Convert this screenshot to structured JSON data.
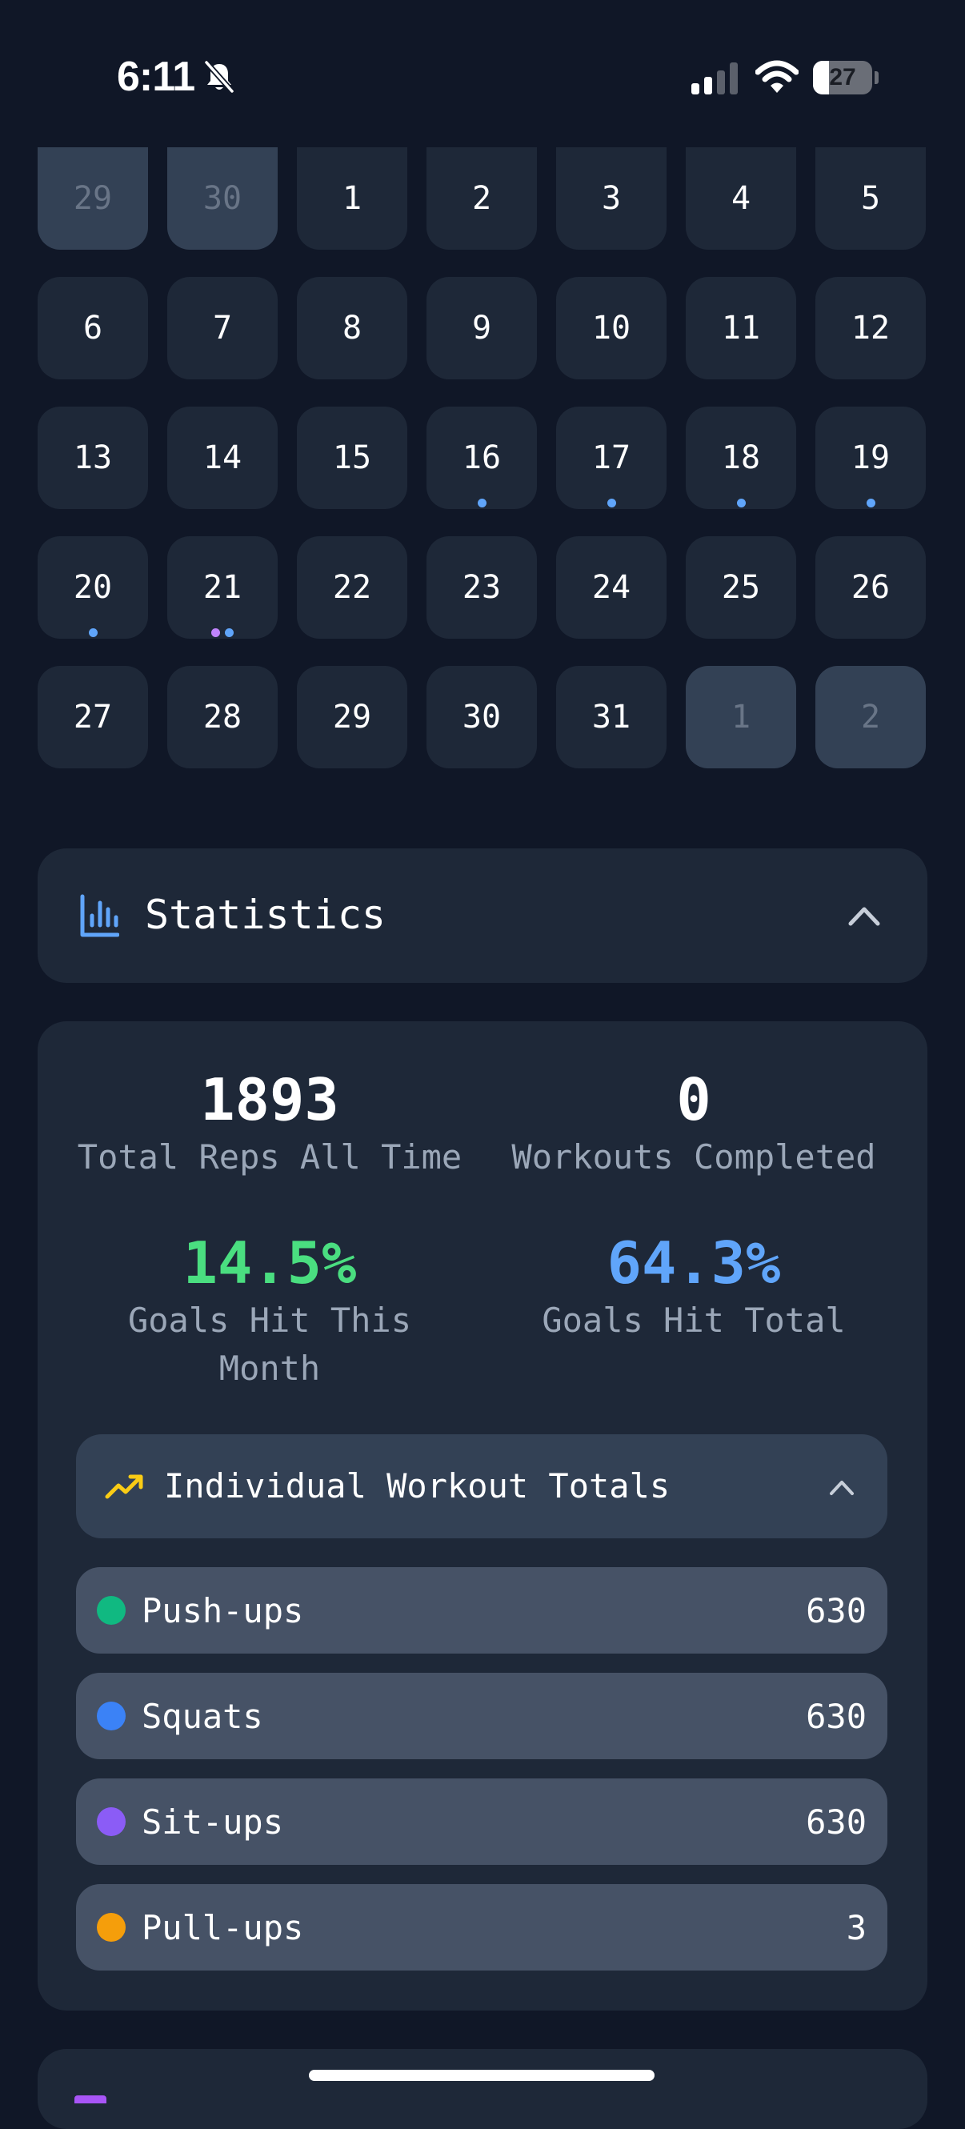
{
  "status_bar": {
    "time": "6:11",
    "battery": "27",
    "battery_level": 0.27
  },
  "calendar": {
    "rows": [
      [
        {
          "day": "29",
          "other": true
        },
        {
          "day": "30",
          "other": true
        },
        {
          "day": "1"
        },
        {
          "day": "2"
        },
        {
          "day": "3"
        },
        {
          "day": "4"
        },
        {
          "day": "5"
        }
      ],
      [
        {
          "day": "6"
        },
        {
          "day": "7"
        },
        {
          "day": "8"
        },
        {
          "day": "9"
        },
        {
          "day": "10"
        },
        {
          "day": "11"
        },
        {
          "day": "12"
        }
      ],
      [
        {
          "day": "13"
        },
        {
          "day": "14"
        },
        {
          "day": "15"
        },
        {
          "day": "16",
          "dots": [
            "#60a5fa"
          ]
        },
        {
          "day": "17",
          "dots": [
            "#60a5fa"
          ]
        },
        {
          "day": "18",
          "dots": [
            "#60a5fa"
          ]
        },
        {
          "day": "19",
          "dots": [
            "#60a5fa"
          ]
        }
      ],
      [
        {
          "day": "20",
          "dots": [
            "#60a5fa"
          ]
        },
        {
          "day": "21",
          "dots": [
            "#c084fc",
            "#60a5fa"
          ]
        },
        {
          "day": "22"
        },
        {
          "day": "23"
        },
        {
          "day": "24"
        },
        {
          "day": "25"
        },
        {
          "day": "26"
        }
      ],
      [
        {
          "day": "27"
        },
        {
          "day": "28"
        },
        {
          "day": "29"
        },
        {
          "day": "30"
        },
        {
          "day": "31"
        },
        {
          "day": "1",
          "other": true
        },
        {
          "day": "2",
          "other": true
        }
      ]
    ]
  },
  "statistics": {
    "title": "Statistics",
    "total_reps": {
      "value": "1893",
      "label": "Total Reps All Time"
    },
    "workouts_completed": {
      "value": "0",
      "label": "Workouts Completed"
    },
    "goals_month": {
      "value": "14.5%",
      "label_line1": "Goals Hit This",
      "label_line2": "Month",
      "color": "#4ade80"
    },
    "goals_total": {
      "value": "64.3%",
      "label": "Goals Hit Total",
      "color": "#60a5fa"
    },
    "individual": {
      "title": "Individual Workout Totals",
      "items": [
        {
          "name": "Push-ups",
          "value": "630",
          "color": "#10b981"
        },
        {
          "name": "Squats",
          "value": "630",
          "color": "#3b82f6"
        },
        {
          "name": "Sit-ups",
          "value": "630",
          "color": "#8b5cf6"
        },
        {
          "name": "Pull-ups",
          "value": "3",
          "color": "#f59e0b"
        }
      ]
    }
  },
  "colors": {
    "accent": "#60a5fa",
    "background": "#101727",
    "card": "#1e2838",
    "trend_icon": "#facc15"
  }
}
